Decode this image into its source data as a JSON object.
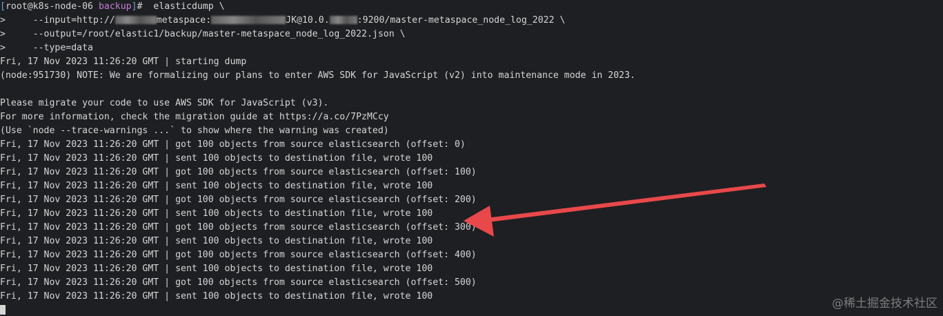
{
  "prompt": {
    "user_host": "root@k8s-node-06",
    "dir": "backup",
    "symbol": "#",
    "command": "elasticdump \\"
  },
  "continuation": [
    {
      "marker": ">",
      "pre": "     --input=http://",
      "mid1": "metaspace:",
      "mid2": "JK@10.0.",
      "post": ":9200/master-metaspace_node_log_2022 \\"
    },
    {
      "marker": ">",
      "text": "     --output=/root/elastic1/backup/master-metaspace_node_log_2022.json \\"
    },
    {
      "marker": ">",
      "text": "     --type=data"
    }
  ],
  "output_lines": [
    "Fri, 17 Nov 2023 11:26:20 GMT | starting dump",
    "(node:951730) NOTE: We are formalizing our plans to enter AWS SDK for JavaScript (v2) into maintenance mode in 2023.",
    "",
    "Please migrate your code to use AWS SDK for JavaScript (v3).",
    "For more information, check the migration guide at https://a.co/7PzMCcy",
    "(Use `node --trace-warnings ...` to show where the warning was created)",
    "Fri, 17 Nov 2023 11:26:20 GMT | got 100 objects from source elasticsearch (offset: 0)",
    "Fri, 17 Nov 2023 11:26:20 GMT | sent 100 objects to destination file, wrote 100",
    "Fri, 17 Nov 2023 11:26:20 GMT | got 100 objects from source elasticsearch (offset: 100)",
    "Fri, 17 Nov 2023 11:26:20 GMT | sent 100 objects to destination file, wrote 100",
    "Fri, 17 Nov 2023 11:26:20 GMT | got 100 objects from source elasticsearch (offset: 200)",
    "Fri, 17 Nov 2023 11:26:20 GMT | sent 100 objects to destination file, wrote 100",
    "Fri, 17 Nov 2023 11:26:20 GMT | got 100 objects from source elasticsearch (offset: 300)",
    "Fri, 17 Nov 2023 11:26:20 GMT | sent 100 objects to destination file, wrote 100",
    "Fri, 17 Nov 2023 11:26:20 GMT | got 100 objects from source elasticsearch (offset: 400)",
    "Fri, 17 Nov 2023 11:26:20 GMT | sent 100 objects to destination file, wrote 100",
    "Fri, 17 Nov 2023 11:26:20 GMT | got 100 objects from source elasticsearch (offset: 500)",
    "Fri, 17 Nov 2023 11:26:20 GMT | sent 100 objects to destination file, wrote 100"
  ],
  "annotation": {
    "icon": "red-arrow-icon",
    "color": "#e8484a"
  },
  "watermark": "@稀土掘金技术社区",
  "colors": {
    "background": "#1e1f22",
    "text": "#d6d6d6",
    "prompt_dir": "#c57dd6",
    "prompt_bracket": "#6fa3d6"
  }
}
